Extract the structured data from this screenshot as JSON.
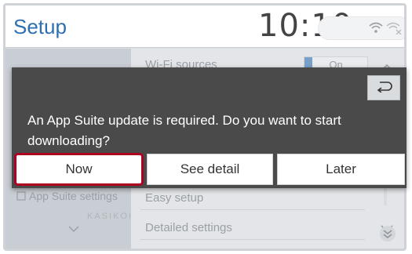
{
  "header": {
    "title": "Setup",
    "clock": "10:10"
  },
  "background": {
    "row1_label": "Wi-Fi sources",
    "row1_toggle": "On",
    "row_easy_setup": "Easy setup",
    "row_detailed_settings": "Detailed settings",
    "left_app_suite_label": "App Suite settings",
    "left_kasikoi_label": "KASIKOI"
  },
  "dialog": {
    "message": "An App Suite update is required. Do you want to start downloading?",
    "buttons": {
      "now": "Now",
      "see_detail": "See detail",
      "later": "Later"
    },
    "selected_button": "Now"
  },
  "icons": {
    "back": "back-arrow-icon",
    "wifi": "wifi-icon",
    "wifi_disabled": "wifi-x-icon",
    "scroll_up": "chevron-up-icon",
    "scroll_down": "chevron-down-icon",
    "scroll_bottom": "double-chevron-down-icon"
  },
  "colors": {
    "accent": "#2d6fb0",
    "dialog_bg": "#4a4a4a",
    "selected_outline": "#b00020"
  }
}
